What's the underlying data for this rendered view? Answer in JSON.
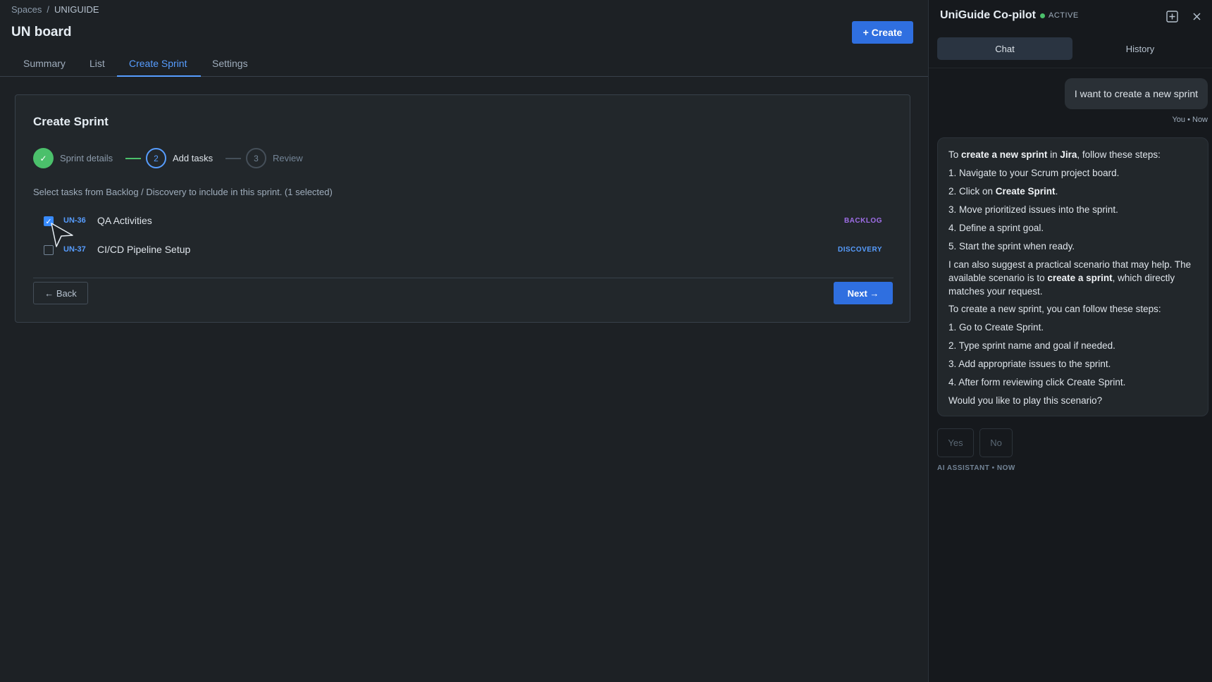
{
  "breadcrumb": {
    "root": "Spaces",
    "separator": "/",
    "current": "UNIGUIDE"
  },
  "page": {
    "title": "UN board",
    "create_label": "+ Create"
  },
  "tabs": [
    {
      "label": "Summary"
    },
    {
      "label": "List"
    },
    {
      "label": "Create Sprint"
    },
    {
      "label": "Settings"
    }
  ],
  "active_tab": "Create Sprint",
  "wizard": {
    "title": "Create Sprint",
    "steps": [
      {
        "number": "✓",
        "label": "Sprint details",
        "state": "done"
      },
      {
        "number": "2",
        "label": "Add tasks",
        "state": "current"
      },
      {
        "number": "3",
        "label": "Review",
        "state": "upcoming"
      }
    ],
    "instructions": "Select tasks from Backlog / Discovery to include in this sprint. (1 selected)",
    "tasks": [
      {
        "key": "UN-36",
        "name": "QA Activities",
        "tag": "BACKLOG",
        "checked": true,
        "tag_color": "#9f6ee8"
      },
      {
        "key": "UN-37",
        "name": "CI/CD Pipeline Setup",
        "tag": "DISCOVERY",
        "checked": false,
        "tag_color": "#579dff"
      }
    ],
    "back_label": "← Back",
    "next_label": "Next →"
  },
  "copilot": {
    "title": "UniGuide Co-pilot",
    "status": "ACTIVE",
    "status_color": "#4bc06b",
    "new_chat_icon": "plus-square-icon",
    "close_icon": "close-icon",
    "tabs": [
      {
        "label": "Chat"
      },
      {
        "label": "History"
      }
    ],
    "user_message": "I want to create a new sprint",
    "user_meta": "You • Now",
    "ai_message": {
      "intro_pre": "To ",
      "intro_bold1": "create a new sprint",
      "intro_mid": " in ",
      "intro_bold2": "Jira",
      "intro_post": ", follow these steps:",
      "steps": [
        "1. Navigate to your Scrum project board.",
        "2. Click on ",
        "3. Move prioritized issues into the sprint.",
        "4. Define a sprint goal.",
        "5. Start the sprint when ready."
      ],
      "step2_bold": "Create Sprint",
      "step2_post": ".",
      "scenario_pre": "I can also suggest a practical scenario that may help. The available scenario is to ",
      "scenario_bold": "create a sprint",
      "scenario_post": ", which directly matches your request.",
      "followup": "To create a new sprint, you can follow these steps:",
      "followup_steps": [
        "1. Go to Create Sprint.",
        "2. Type sprint name and goal if needed.",
        "3. Add appropriate issues to the sprint.",
        "4. After form reviewing click Create Sprint."
      ],
      "question": "Would you like to play this scenario?"
    },
    "yes_label": "Yes",
    "no_label": "No",
    "ai_meta": "AI ASSISTANT • NOW"
  }
}
